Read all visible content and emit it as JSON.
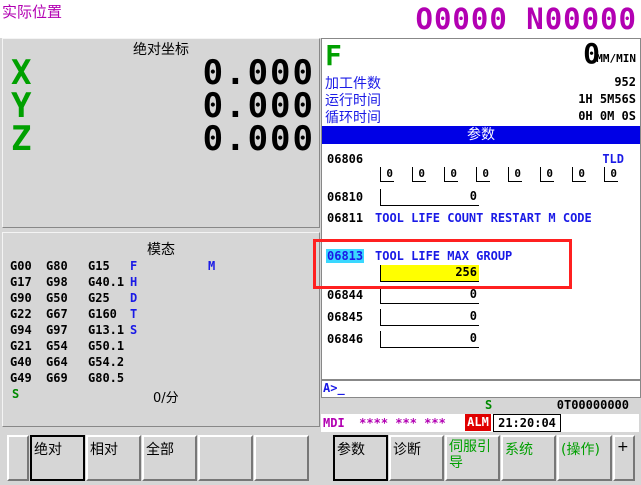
{
  "header": {
    "screen_title": "实际位置",
    "program_number": "O0000 N00000"
  },
  "absolute": {
    "title": "绝对坐标",
    "axes": [
      {
        "name": "X",
        "value": "0.000"
      },
      {
        "name": "Y",
        "value": "0.000"
      },
      {
        "name": "Z",
        "value": "0.000"
      }
    ]
  },
  "modal": {
    "title": "模态",
    "rows": [
      [
        "G00",
        "G80",
        "G15",
        "F",
        "M"
      ],
      [
        "G17",
        "G98",
        "G40.1",
        "H",
        ""
      ],
      [
        "G90",
        "G50",
        "G25",
        "D",
        ""
      ],
      [
        "G22",
        "G67",
        "G160",
        "T",
        ""
      ],
      [
        "G94",
        "G97",
        "G13.1",
        "S",
        ""
      ],
      [
        "G21",
        "G54",
        "G50.1",
        "",
        ""
      ],
      [
        "G40",
        "G64",
        "G54.2",
        "",
        ""
      ],
      [
        "G49",
        "G69",
        "G80.5",
        "",
        ""
      ]
    ],
    "s_label": "S",
    "per_min": "0/分"
  },
  "feed": {
    "label": "F",
    "value": "0",
    "unit": "MM/MIN"
  },
  "info": [
    {
      "label": "加工件数",
      "value": "952"
    },
    {
      "label": "运行时间",
      "value": "1H 5M56S"
    },
    {
      "label": "循环时间",
      "value": "0H 0M 0S"
    }
  ],
  "params": {
    "title": "参数",
    "p06806": {
      "number": "06806",
      "tag": "TLD",
      "bits": [
        "0",
        "0",
        "0",
        "0",
        "0",
        "0",
        "0",
        "0"
      ]
    },
    "p06810": {
      "number": "06810",
      "value": "0"
    },
    "p06811": {
      "number": "06811",
      "desc": "TOOL LIFE COUNT RESTART M CODE"
    },
    "p06813": {
      "number": "06813",
      "desc": "TOOL LIFE MAX GROUP",
      "value": "256"
    },
    "p06844": {
      "number": "06844",
      "value": "0"
    },
    "p06845": {
      "number": "06845",
      "value": "0"
    },
    "p06846": {
      "number": "06846",
      "value": "0"
    }
  },
  "input_line": "A>_",
  "spindle_line": {
    "s": "S",
    "tool": "0T00000000"
  },
  "status": {
    "mode": "MDI",
    "stars": "**** *** ***",
    "alarm": "ALM",
    "time": "21:20:04"
  },
  "softkeys_left": [
    "",
    "绝对",
    "相对",
    "全部",
    "",
    ""
  ],
  "softkeys_right": [
    "参数",
    "诊断",
    "伺服引导",
    "系统",
    "(操作)",
    "+"
  ],
  "colors": {
    "magenta": "#b200b2",
    "green": "#00a000",
    "blue": "#1a1ae6",
    "highlight_yellow": "#ffff00",
    "alarm_red": "#e00000"
  }
}
